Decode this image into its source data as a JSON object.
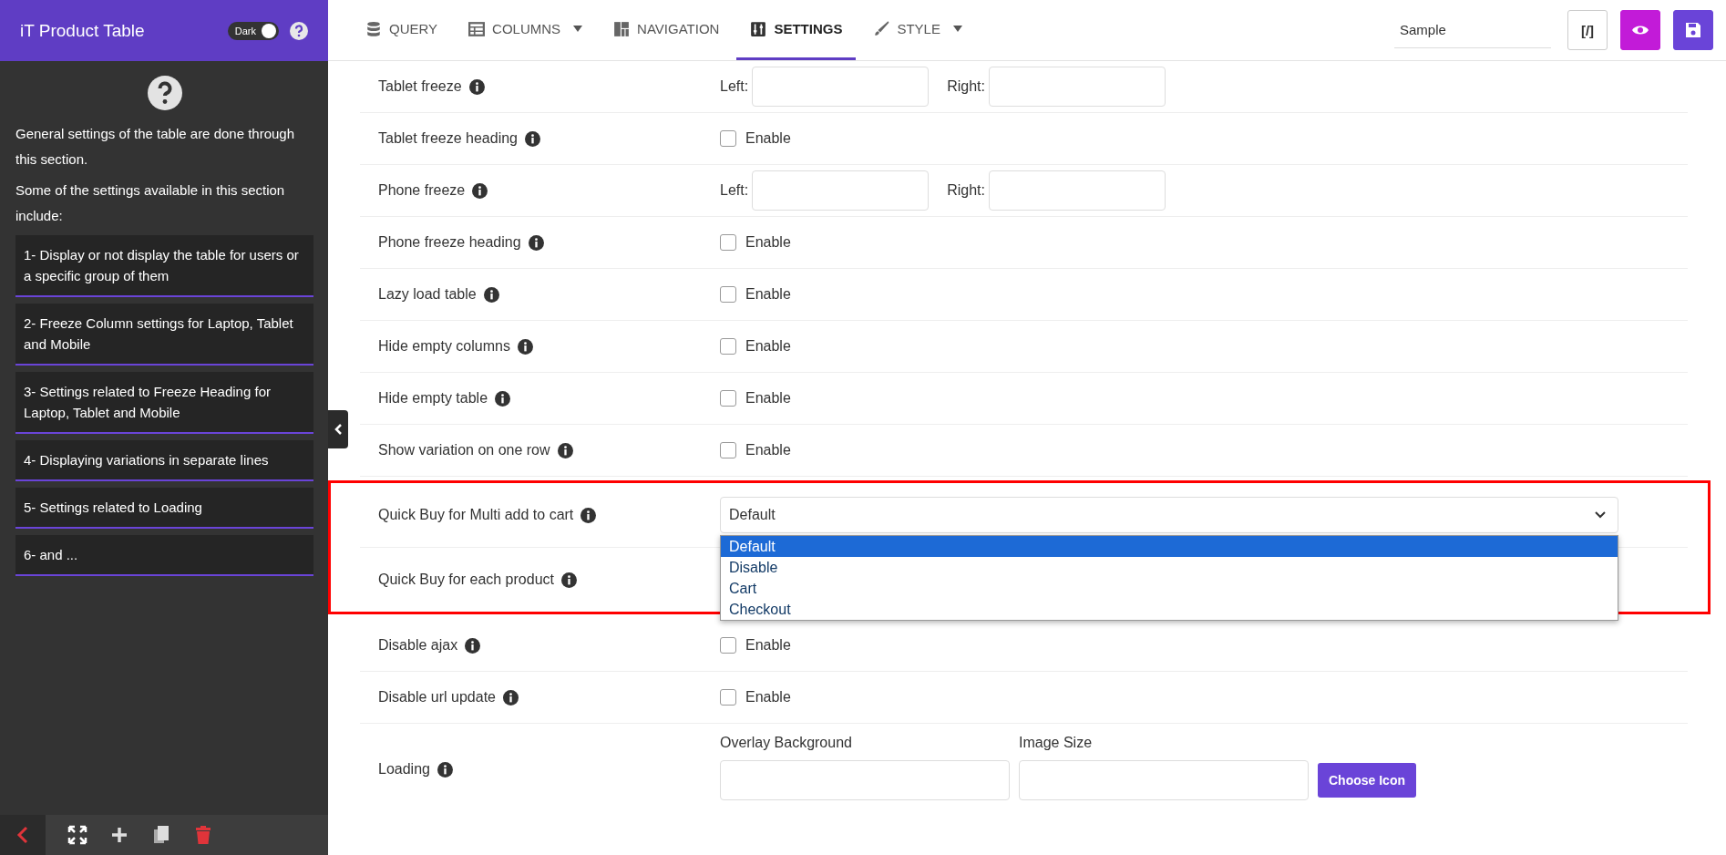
{
  "app": {
    "title": "iT Product Table",
    "theme_toggle": {
      "label": "Dark",
      "on": true
    }
  },
  "nav": {
    "tabs": [
      {
        "label": "QUERY",
        "dropdown": false,
        "selected": false
      },
      {
        "label": "COLUMNS",
        "dropdown": true,
        "selected": false
      },
      {
        "label": "NAVIGATION",
        "dropdown": false,
        "selected": false
      },
      {
        "label": "SETTINGS",
        "dropdown": false,
        "selected": true
      },
      {
        "label": "STYLE",
        "dropdown": true,
        "selected": false
      }
    ],
    "name_field": {
      "value": "Sample"
    },
    "code_button": "[/]"
  },
  "sidebar": {
    "intro": [
      "General settings of the table are done through this section.",
      "Some of the settings available in this section include:"
    ],
    "items": [
      "1- Display or not display the table for users or a specific group of them",
      "2- Freeze Column settings for Laptop, Tablet and Mobile",
      "3- Settings related to Freeze Heading for Laptop, Tablet and Mobile",
      "4- Displaying variations in separate lines",
      "5- Settings related to Loading",
      "6- and ..."
    ]
  },
  "settings": [
    {
      "kind": "freeze",
      "label": "Tablet freeze",
      "left_label": "Left:",
      "right_label": "Right:"
    },
    {
      "kind": "checkbox",
      "label": "Tablet freeze heading",
      "option": "Enable",
      "checked": false
    },
    {
      "kind": "freeze",
      "label": "Phone freeze",
      "left_label": "Left:",
      "right_label": "Right:"
    },
    {
      "kind": "checkbox",
      "label": "Phone freeze heading",
      "option": "Enable",
      "checked": false
    },
    {
      "kind": "checkbox",
      "label": "Lazy load table",
      "option": "Enable",
      "checked": false
    },
    {
      "kind": "checkbox",
      "label": "Hide empty columns",
      "option": "Enable",
      "checked": false
    },
    {
      "kind": "checkbox",
      "label": "Hide empty table",
      "option": "Enable",
      "checked": false
    },
    {
      "kind": "checkbox",
      "label": "Show variation on one row",
      "option": "Enable",
      "checked": false
    },
    {
      "kind": "highlight_group",
      "rows": [
        {
          "kind": "select",
          "label": "Quick Buy for Multi add to cart",
          "value": "Default",
          "open": true,
          "options": [
            {
              "label": "Default",
              "selected": true
            },
            {
              "label": "Disable",
              "selected": false
            },
            {
              "label": "Cart",
              "selected": false
            },
            {
              "label": "Checkout",
              "selected": false
            }
          ]
        },
        {
          "kind": "select_hidden",
          "label": "Quick Buy for each product"
        }
      ]
    },
    {
      "kind": "checkbox",
      "label": "Disable ajax",
      "option": "Enable",
      "checked": false
    },
    {
      "kind": "checkbox",
      "label": "Disable url update",
      "option": "Enable",
      "checked": false
    },
    {
      "kind": "loading",
      "label": "Loading",
      "field_labels": [
        "Overlay Background",
        "Image Size"
      ],
      "button": "Choose Icon"
    }
  ]
}
